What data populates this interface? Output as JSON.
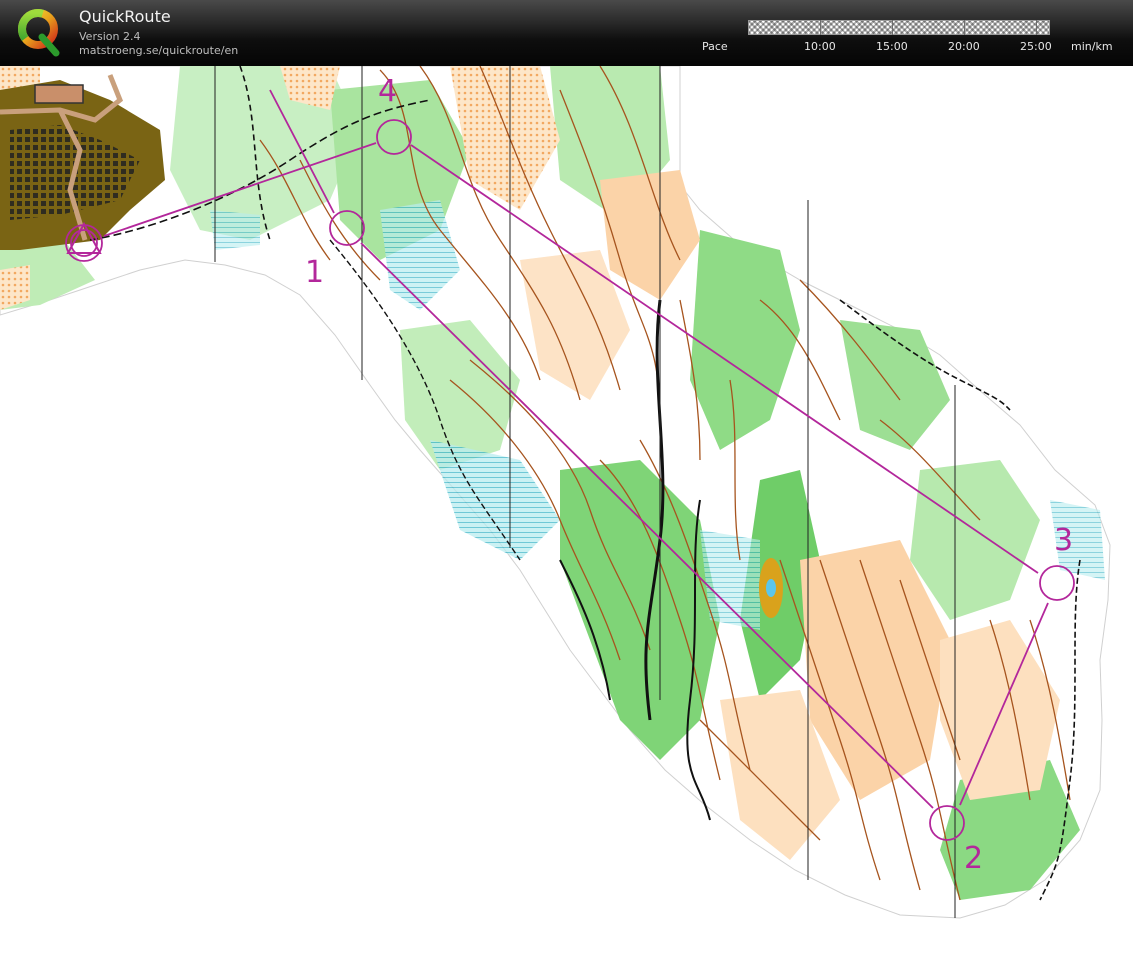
{
  "app": {
    "title": "QuickRoute",
    "version": "Version 2.4",
    "url": "matstroeng.se/quickroute/en"
  },
  "pace_scale": {
    "label": "Pace",
    "ticks": [
      "10:00",
      "15:00",
      "20:00",
      "25:00"
    ],
    "unit": "min/km"
  },
  "course": {
    "color": "#b3279b",
    "start": "start-triangle",
    "controls": [
      {
        "number": "1"
      },
      {
        "number": "2"
      },
      {
        "number": "3"
      },
      {
        "number": "4"
      }
    ]
  },
  "map_colors": {
    "forest_open": "#fbd2a6",
    "vegetation_green": "#89d982",
    "contour_brown": "#a6541e",
    "settlement": "#7a6414",
    "water_blue": "#5bc6ec",
    "paper": "#ffffff"
  }
}
